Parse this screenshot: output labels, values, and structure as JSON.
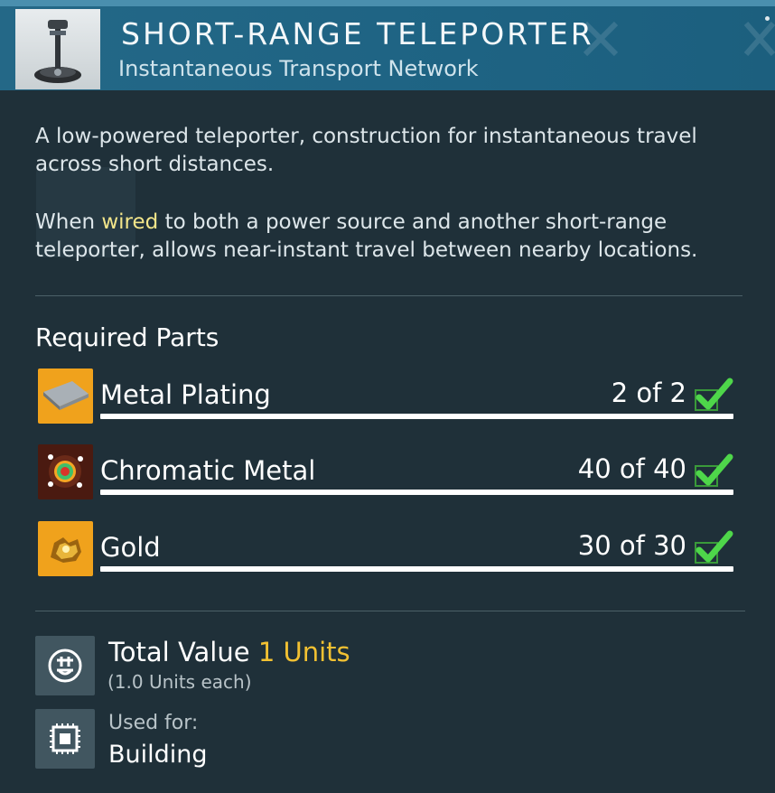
{
  "header": {
    "title": "SHORT-RANGE TELEPORTER",
    "subtitle": "Instantaneous Transport Network",
    "thumbnail_icon": "teleporter-icon"
  },
  "description": {
    "para1": "A low-powered teleporter, construction for instantaneous travel across short distances.",
    "para2_before": "When ",
    "para2_highlight": "wired",
    "para2_after": " to both a power source and another short-range teleporter, allows near-instant travel between nearby locations.",
    "highlight_color": "#f2e58a"
  },
  "required_parts": {
    "heading": "Required Parts",
    "items": [
      {
        "name": "Metal Plating",
        "quantity": "2 of 2",
        "complete": true,
        "icon": "metal-plating-icon",
        "icon_bg": "#f0a21c"
      },
      {
        "name": "Chromatic Metal",
        "quantity": "40 of 40",
        "complete": true,
        "icon": "chromatic-metal-icon",
        "icon_bg": "#4a1a10"
      },
      {
        "name": "Gold",
        "quantity": "30 of 30",
        "complete": true,
        "icon": "gold-icon",
        "icon_bg": "#f0a21c"
      }
    ],
    "check_color": "#4ed64a"
  },
  "value": {
    "label": "Total Value",
    "amount": "1 Units",
    "each": "(1.0 Units each)",
    "icon": "units-icon",
    "amount_color": "#f2c132"
  },
  "used_for": {
    "label": "Used for:",
    "value": "Building",
    "icon": "building-chip-icon"
  }
}
